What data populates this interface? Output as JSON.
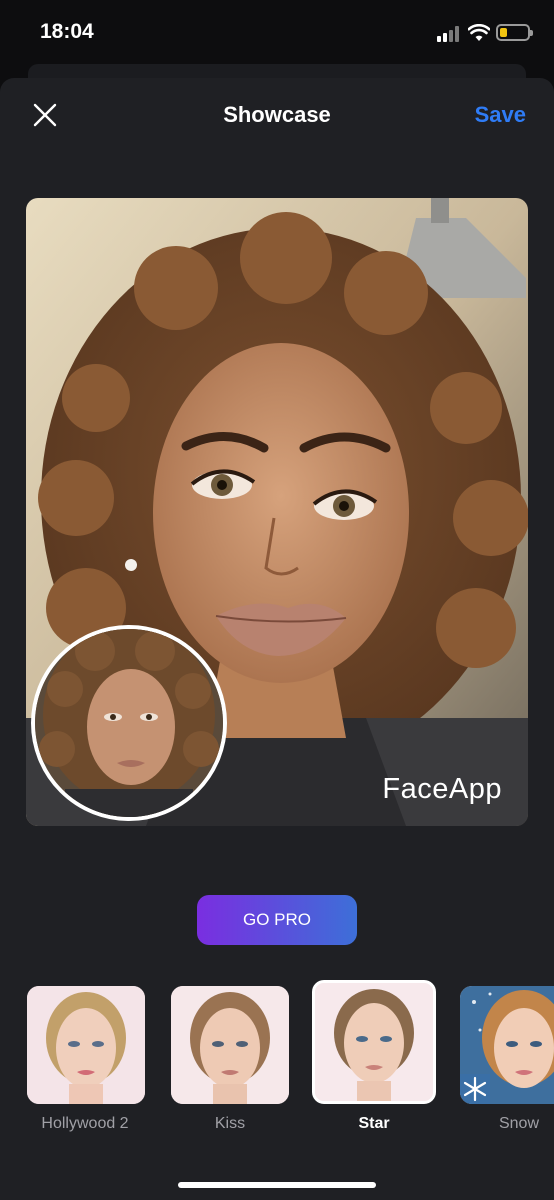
{
  "status_bar": {
    "time": "18:04"
  },
  "header": {
    "title": "Showcase",
    "save_label": "Save"
  },
  "photo": {
    "watermark": "FaceApp"
  },
  "go_pro_label": "GO PRO",
  "filters": [
    {
      "label": "Hollywood 2",
      "selected": false
    },
    {
      "label": "Kiss",
      "selected": false
    },
    {
      "label": "Star",
      "selected": true
    },
    {
      "label": "Snow",
      "selected": false
    }
  ],
  "colors": {
    "accent": "#2f7cf6",
    "go_pro_start": "#7a2ee0",
    "go_pro_end": "#3d6fd8",
    "battery": "#f2c511"
  }
}
